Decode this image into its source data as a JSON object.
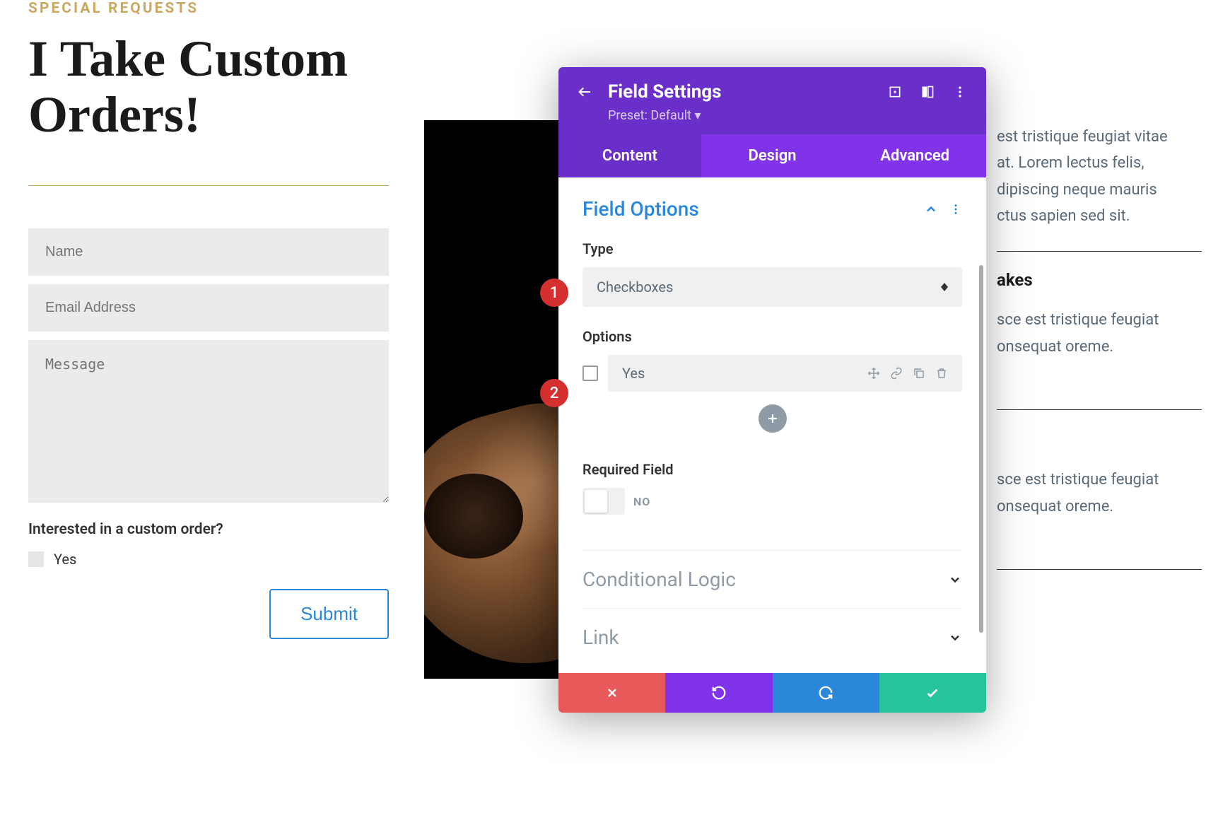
{
  "left": {
    "eyebrow": "SPECIAL REQUESTS",
    "headline": "I Take Custom Orders!",
    "name_placeholder": "Name",
    "email_placeholder": "Email Address",
    "message_placeholder": "Message",
    "checkbox_question": "Interested in a custom order?",
    "checkbox_option": "Yes",
    "submit_label": "Submit"
  },
  "right": {
    "line1": "est tristique feugiat vitae",
    "line2": "at. Lorem lectus felis,",
    "line3": "dipiscing neque mauris",
    "line4": "ctus sapien sed sit.",
    "heading1": "akes",
    "para1a": "sce est tristique feugiat",
    "para1b": "onsequat oreme.",
    "para2a": "sce est tristique feugiat",
    "para2b": "onsequat oreme."
  },
  "panel": {
    "title": "Field Settings",
    "preset": "Preset: Default ▾",
    "tabs": {
      "content": "Content",
      "design": "Design",
      "advanced": "Advanced"
    },
    "section": "Field Options",
    "type_label": "Type",
    "type_value": "Checkboxes",
    "options_label": "Options",
    "option_value": "Yes",
    "required_label": "Required Field",
    "required_value": "NO",
    "conditional": "Conditional Logic",
    "link": "Link"
  },
  "badges": {
    "one": "1",
    "two": "2"
  }
}
